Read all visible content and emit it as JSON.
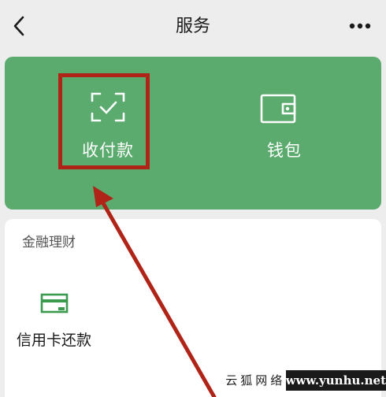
{
  "header": {
    "title": "服务"
  },
  "hero": {
    "items": [
      {
        "label": "收付款",
        "icon": "scan-pay-icon"
      },
      {
        "label": "钱包",
        "icon": "wallet-icon"
      }
    ],
    "color": "#5bab6e"
  },
  "finance": {
    "title": "金融理财",
    "items": [
      {
        "label": "信用卡还款",
        "icon": "credit-card-icon"
      }
    ]
  },
  "annotation": {
    "highlight_color": "#b02418"
  },
  "watermark": {
    "cn": "云狐网络",
    "url": "www.yunhu.net"
  }
}
